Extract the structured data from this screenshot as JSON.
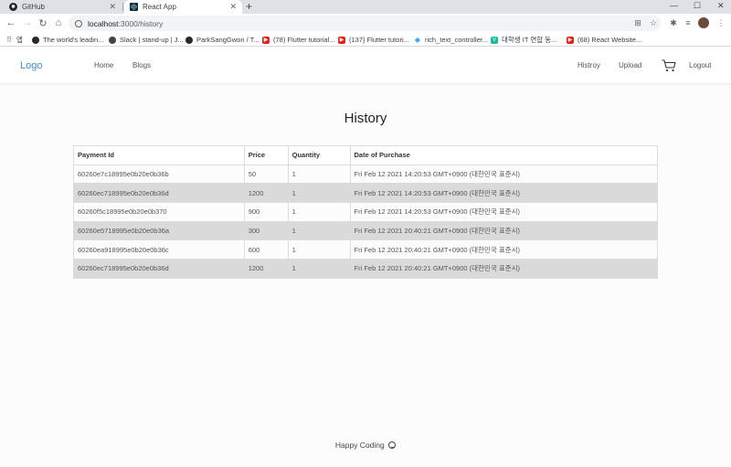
{
  "browser": {
    "tabs": [
      {
        "title": "GitHub",
        "icon": "github-icon"
      },
      {
        "title": "React App",
        "icon": "react-icon"
      }
    ],
    "new_tab": "+",
    "address": {
      "host": "localhost",
      "path": ":3000/history"
    },
    "bookmarks": [
      {
        "label": "앱",
        "icon": "apps-icon"
      },
      {
        "label": "The world's leadin...",
        "icon": "github-icon"
      },
      {
        "label": "Slack | stand-up | J...",
        "icon": "slack-icon"
      },
      {
        "label": "ParkSangGwon / T...",
        "icon": "github-icon"
      },
      {
        "label": "(78) Flutter tutorial...",
        "icon": "youtube-icon"
      },
      {
        "label": "(137) Flutter tutori...",
        "icon": "youtube-icon"
      },
      {
        "label": "rich_text_controller...",
        "icon": "flutter-icon"
      },
      {
        "label": "대학생 IT 연합 동...",
        "icon": "v-icon"
      },
      {
        "label": "(68) React Website...",
        "icon": "youtube-icon"
      }
    ]
  },
  "navbar": {
    "logo": "Logo",
    "left_links": [
      "Home",
      "Blogs"
    ],
    "right_links": [
      "Histroy",
      "Upload"
    ],
    "logout": "Logout"
  },
  "page": {
    "title": "History",
    "columns": [
      "Payment Id",
      "Price",
      "Quantity",
      "Date of Purchase"
    ],
    "rows": [
      [
        "60260e7c18995e0b20e0b36b",
        "50",
        "1",
        "Fri Feb 12 2021 14:20:53 GMT+0900 (대한민국 표준시)"
      ],
      [
        "60260ec718995e0b20e0b36d",
        "1200",
        "1",
        "Fri Feb 12 2021 14:20:53 GMT+0900 (대한민국 표준시)"
      ],
      [
        "60260f5c18995e0b20e0b370",
        "900",
        "1",
        "Fri Feb 12 2021 14:20:53 GMT+0900 (대한민국 표준시)"
      ],
      [
        "60260e5718995e0b20e0b36a",
        "300",
        "1",
        "Fri Feb 12 2021 20:40:21 GMT+0900 (대한민국 표준시)"
      ],
      [
        "60260ea918995e0b20e0b36c",
        "600",
        "1",
        "Fri Feb 12 2021 20:40:21 GMT+0900 (대한민국 표준시)"
      ],
      [
        "60260ec718995e0b20e0b36d",
        "1200",
        "1",
        "Fri Feb 12 2021 20:40:21 GMT+0900 (대한민국 표준시)"
      ]
    ],
    "footer": "Happy Coding"
  },
  "colors": {
    "logo": "#3b8fd6",
    "stripe": "#dadada"
  }
}
